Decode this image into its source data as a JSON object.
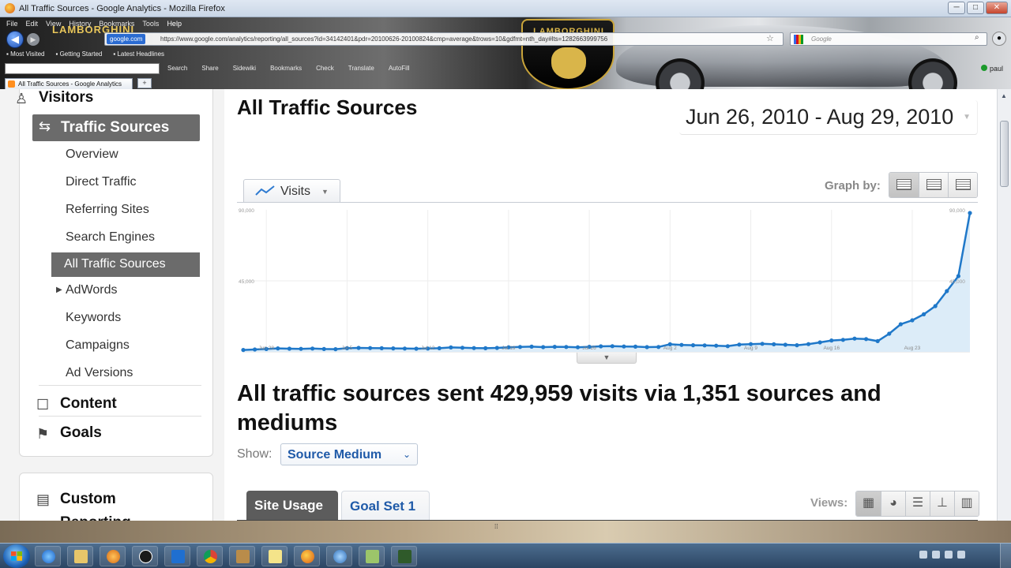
{
  "window": {
    "title": "All Traffic Sources - Google Analytics - Mozilla Firefox"
  },
  "menubar": [
    "File",
    "Edit",
    "View",
    "History",
    "Bookmarks",
    "Tools",
    "Help"
  ],
  "nav": {
    "site_label": "google.com",
    "url": "https://www.google.com/analytics/reporting/all_sources?id=34142401&pdr=20100626-20100824&cmp=average&trows=10&gdfmt=nth_day#lts=1282663999756",
    "search_placeholder": "Google"
  },
  "bookmarks": [
    "Most Visited",
    "Getting Started",
    "Latest Headlines"
  ],
  "toolbar2": {
    "items": [
      "Search",
      "Share",
      "Sidewiki",
      "Bookmarks",
      "Check",
      "Translate",
      "AutoFill"
    ],
    "user": "paul"
  },
  "theme": {
    "brand": "LAMBORGHINI"
  },
  "browser_tab": {
    "label": "All Traffic Sources - Google Analytics"
  },
  "sidebar": {
    "visitors": "Visitors",
    "traffic_sources": "Traffic Sources",
    "items": [
      {
        "label": "Overview"
      },
      {
        "label": "Direct Traffic"
      },
      {
        "label": "Referring Sites"
      },
      {
        "label": "Search Engines"
      },
      {
        "label": "All Traffic Sources"
      },
      {
        "label": "AdWords"
      },
      {
        "label": "Keywords"
      },
      {
        "label": "Campaigns"
      },
      {
        "label": "Ad Versions"
      }
    ],
    "content": "Content",
    "goals": "Goals",
    "custom_reporting": "Custom Reporting"
  },
  "main": {
    "title": "All Traffic Sources",
    "date_range": "Jun 26, 2010 - Aug 29, 2010",
    "metric": "Visits",
    "graph_by": "Graph by:",
    "summary": "All traffic sources sent 429,959 visits via 1,351 sources and mediums",
    "show_label": "Show:",
    "show_value": "Source Medium",
    "tab_usage": "Site Usage",
    "tab_goal": "Goal Set 1",
    "views_label": "Views:"
  },
  "colors": {
    "series": "#1f78c9",
    "area": "#dcecf8",
    "accent_blue": "#1f5aa8"
  },
  "chart_data": {
    "type": "line",
    "title": "",
    "ylim": [
      0,
      90000
    ],
    "y_ticks": [
      "90,000",
      "45,000"
    ],
    "right_ticks": [
      "90,000",
      "45,000"
    ],
    "x_tick_labels": [
      "Jun 28",
      "Jul 5",
      "Jul 12",
      "Jul 19",
      "Jul 26",
      "Aug 2",
      "Aug 9",
      "Aug 16",
      "Aug 23"
    ],
    "x_tick_index": [
      2,
      9,
      16,
      23,
      30,
      37,
      44,
      51,
      58
    ],
    "series": [
      {
        "name": "Visits",
        "values": [
          1200,
          1500,
          1800,
          2200,
          2000,
          1900,
          2100,
          1800,
          1700,
          2300,
          2500,
          2400,
          2300,
          2200,
          2100,
          2000,
          2100,
          2300,
          2800,
          2600,
          2400,
          2300,
          2500,
          2900,
          3100,
          3300,
          3000,
          3200,
          3100,
          2900,
          3200,
          3500,
          3600,
          3400,
          3300,
          3000,
          3100,
          4800,
          4400,
          4200,
          4100,
          3900,
          3600,
          4600,
          4900,
          5100,
          4800,
          4500,
          4200,
          4900,
          6000,
          7200,
          7600,
          8400,
          8100,
          6800,
          11500,
          17500,
          20000,
          23800,
          29000,
          38500,
          48000,
          88000
        ]
      }
    ]
  }
}
